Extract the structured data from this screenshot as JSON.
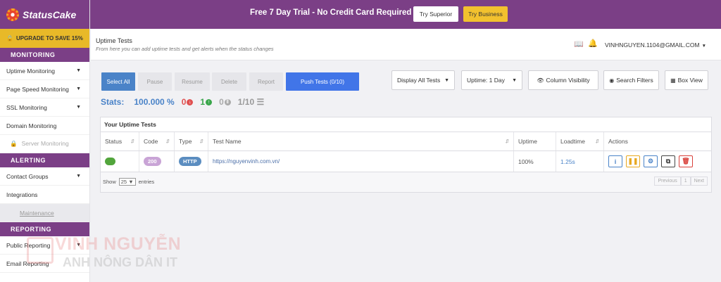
{
  "sidebar": {
    "brand": "StatusCake",
    "upgrade": "UPGRADE TO SAVE 15%",
    "sections": {
      "monitoring": "MONITORING",
      "alerting": "ALERTING",
      "reporting": "REPORTING"
    },
    "items": {
      "uptime": "Uptime Monitoring",
      "pagespeed": "Page Speed Monitoring",
      "ssl": "SSL Monitoring",
      "domain": "Domain Monitoring",
      "server": "Server Monitoring",
      "contact_groups": "Contact Groups",
      "integrations": "Integrations",
      "maintenance": "Maintenance",
      "public_reporting": "Public Reporting",
      "email_reporting": "Email Reporting"
    }
  },
  "banner": {
    "text": "Free 7 Day Trial - No Credit Card Required",
    "try_superior": "Try Superior",
    "try_business": "Try Business"
  },
  "header": {
    "title": "Uptime Tests",
    "subtitle": "From here you can add uptime tests and get alerts when the status changes",
    "user": "VINHNGUYEN.1104@GMAIL.COM"
  },
  "toolbar": {
    "select_all": "Select All",
    "pause": "Pause",
    "resume": "Resume",
    "delete": "Delete",
    "report": "Report",
    "push_tests": "Push Tests (0/10)",
    "display_filter": "Display All Tests",
    "uptime_range": "Uptime: 1 Day",
    "column_visibility": "Column Visibility",
    "search_filters": "Search Filters",
    "box_view": "Box View"
  },
  "stats": {
    "label": "Stats:",
    "uptime": "100.000 %",
    "down": "0",
    "up": "1",
    "paused": "0",
    "count": "1/10"
  },
  "table": {
    "title": "Your Uptime Tests",
    "columns": {
      "status": "Status",
      "code": "Code",
      "type": "Type",
      "name": "Test Name",
      "uptime": "Uptime",
      "loadtime": "Loadtime",
      "actions": "Actions"
    },
    "rows": [
      {
        "code": "200",
        "type": "HTTP",
        "name": "https://nguyenvinh.com.vn/",
        "uptime": "100%",
        "loadtime": "1.25s"
      }
    ],
    "show_label": "Show",
    "page_size": "25",
    "entries_label": "entries",
    "pager": {
      "previous": "Previous",
      "page": "1",
      "next": "Next"
    }
  },
  "watermark": {
    "line1": "VINH NGUYỄN",
    "line2": "ANH NÔNG DÂN IT"
  },
  "colors": {
    "brand_purple": "#7b3f86",
    "upgrade_yellow": "#e8b928",
    "primary_blue": "#4a83c8",
    "push_blue": "#4175e8",
    "status_up_green": "#52a53c"
  }
}
